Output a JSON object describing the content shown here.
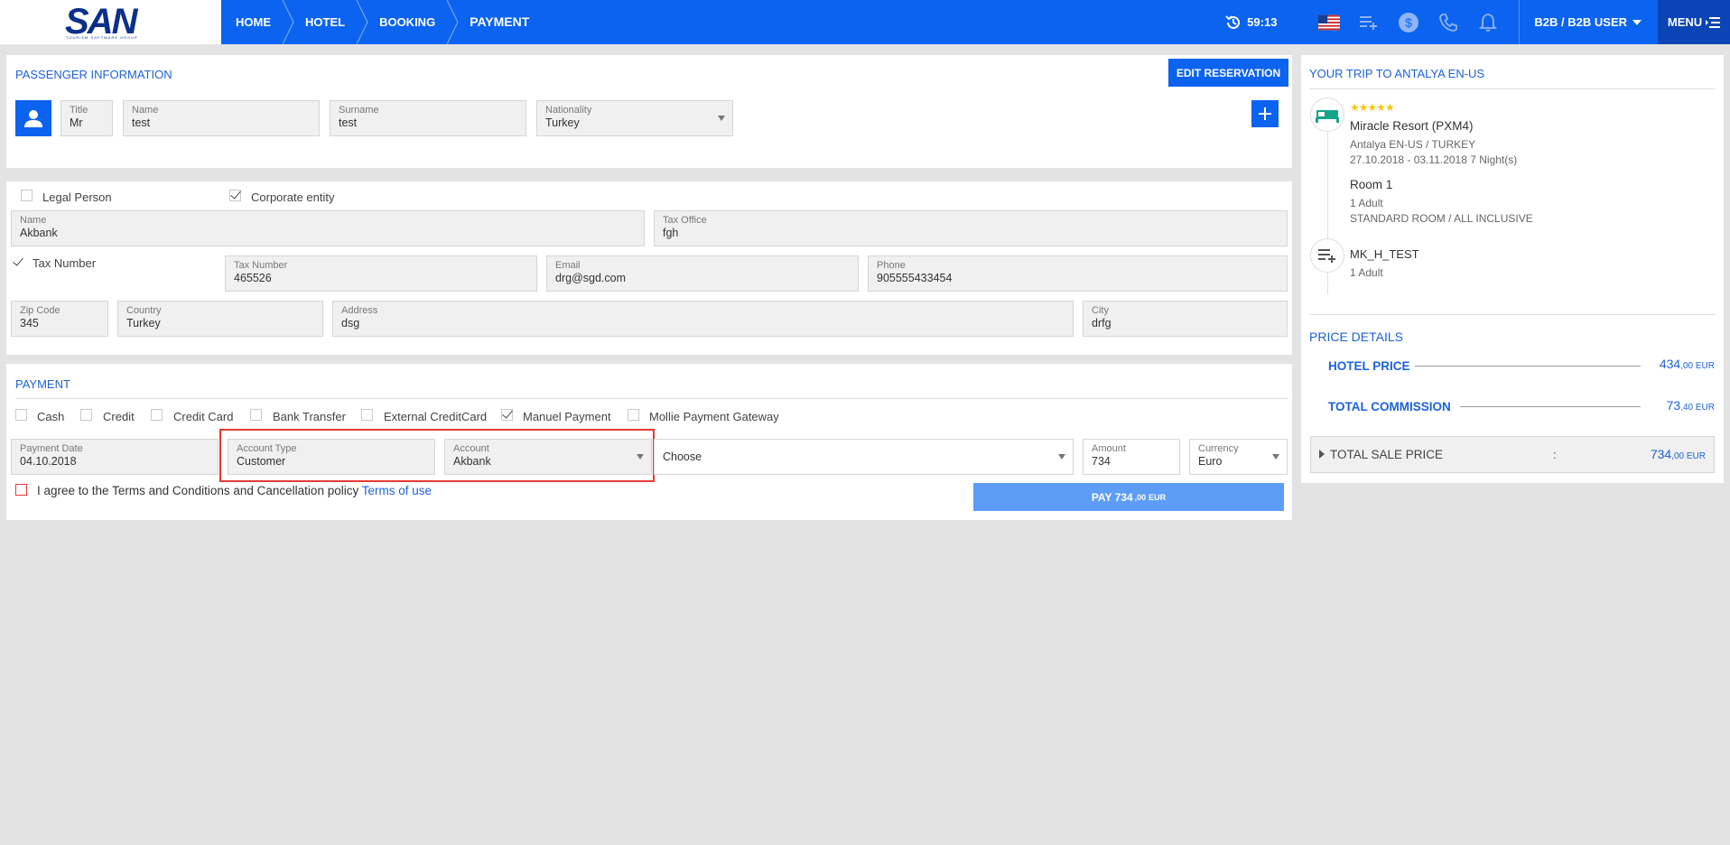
{
  "header": {
    "logo": "SAN",
    "logo_sub": "TOURISM SOFTWARE GROUP",
    "breadcrumbs": [
      "HOME",
      "HOTEL",
      "BOOKING",
      "PAYMENT"
    ],
    "timer": "59:13",
    "user": "B2B / B2B USER",
    "menu": "MENU",
    "icons": [
      "us-flag-icon",
      "list-add-icon",
      "dollar-icon",
      "phone-icon",
      "bell-icon"
    ]
  },
  "passenger": {
    "title": "PASSENGER INFORMATION",
    "edit_button": "EDIT RESERVATION",
    "fields": {
      "title": {
        "label": "Title",
        "value": "Mr"
      },
      "name": {
        "label": "Name",
        "value": "test"
      },
      "surname": {
        "label": "Surname",
        "value": "test"
      },
      "nationality": {
        "label": "Nationality",
        "value": "Turkey"
      }
    }
  },
  "invoice": {
    "legal_person": "Legal Person",
    "corporate_entity": "Corporate entity",
    "tax_number_check": "Tax Number",
    "fields": {
      "name": {
        "label": "Name",
        "value": "Akbank"
      },
      "tax_office": {
        "label": "Tax Office",
        "value": "fgh"
      },
      "tax_number": {
        "label": "Tax Number",
        "value": "465526"
      },
      "email": {
        "label": "Email",
        "value": "drg@sgd.com"
      },
      "phone": {
        "label": "Phone",
        "value": "905555433454"
      },
      "zip": {
        "label": "Zip Code",
        "value": "345"
      },
      "country": {
        "label": "Country",
        "value": "Turkey"
      },
      "address": {
        "label": "Address",
        "value": "dsg"
      },
      "city": {
        "label": "City",
        "value": "drfg"
      }
    }
  },
  "payment": {
    "title": "PAYMENT",
    "methods": [
      "Cash",
      "Credit",
      "Credit Card",
      "Bank Transfer",
      "External CreditCard",
      "Manuel Payment",
      "Mollie Payment Gateway"
    ],
    "fields": {
      "payment_date": {
        "label": "Payment Date",
        "value": "04.10.2018"
      },
      "account_type": {
        "label": "Account Type",
        "value": "Customer"
      },
      "account": {
        "label": "Account",
        "value": "Akbank"
      },
      "choose": "Choose",
      "amount": {
        "label": "Amount",
        "value": "734"
      },
      "currency": {
        "label": "Currency",
        "value": "Euro"
      }
    },
    "agree_text": "I agree to the Terms and Conditions and Cancellation policy",
    "terms_link": "Terms of use",
    "pay_button": {
      "main": "PAY 734",
      "decimals": ",00",
      "currency": "EUR"
    }
  },
  "trip": {
    "title": "YOUR TRIP TO ANTALYA EN-US",
    "stars": "★★★★★",
    "hotel": "Miracle Resort (PXM4)",
    "location": "Antalya EN-US / TURKEY",
    "dates": "27.10.2018 - 03.11.2018 7 Night(s)",
    "room": "Room 1",
    "room_pax": "1 Adult",
    "room_type": "STANDARD ROOM / ALL INCLUSIVE",
    "extra": "MK_H_TEST",
    "extra_pax": "1 Adult"
  },
  "prices": {
    "title": "PRICE DETAILS",
    "hotel_price": {
      "label": "HOTEL PRICE",
      "int": "434",
      "dec": ",00 EUR"
    },
    "commission": {
      "label": "TOTAL COMMISSION",
      "int": "73",
      "dec": ",40 EUR"
    },
    "total": {
      "label": "TOTAL SALE PRICE",
      "sep": ":",
      "int": "734",
      "dec": ",00 EUR"
    }
  },
  "colors": {
    "primary": "#0b63f0",
    "link": "#1c62d8",
    "highlight": "#e53935"
  }
}
